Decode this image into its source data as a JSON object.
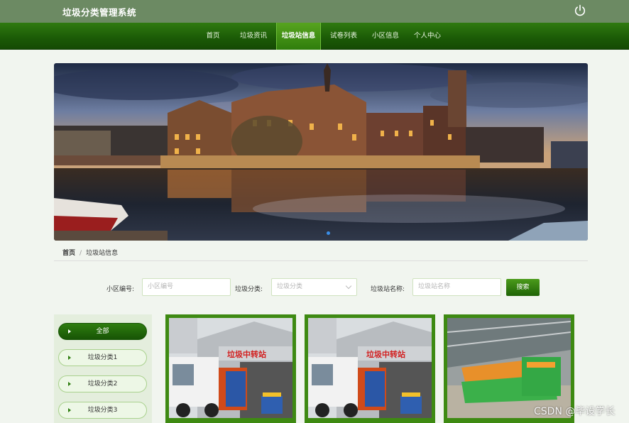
{
  "header": {
    "title": "垃圾分类管理系统",
    "logout_icon": "power-icon"
  },
  "nav": {
    "items": [
      {
        "label": "首页"
      },
      {
        "label": "垃圾资讯"
      },
      {
        "label": "垃圾站信息",
        "active": true
      },
      {
        "label": "试卷列表"
      },
      {
        "label": "小区信息"
      },
      {
        "label": "个人中心"
      }
    ]
  },
  "banner": {
    "slides": 1,
    "active_dot": 1
  },
  "breadcrumb": {
    "home": "首页",
    "separator": "/",
    "current": "垃圾站信息"
  },
  "search": {
    "community_label": "小区编号:",
    "community_placeholder": "小区编号",
    "category_label": "垃圾分类:",
    "category_placeholder": "垃圾分类",
    "station_label": "垃圾站名称:",
    "station_placeholder": "垃圾站名称",
    "button": "搜索"
  },
  "sidebar": {
    "items": [
      {
        "label": "全部",
        "active": true
      },
      {
        "label": "垃圾分类1"
      },
      {
        "label": "垃圾分类2"
      },
      {
        "label": "垃圾分类3"
      }
    ]
  },
  "cards": [
    {
      "sign_text": "垃圾中转站"
    },
    {
      "sign_text": "垃圾中转站"
    },
    {
      "sign_text": ""
    }
  ],
  "watermark": "CSDN @毕设学长",
  "colors": {
    "primary": "#1b5a06",
    "accent": "#3e8a12",
    "header": "#6c8a63"
  }
}
